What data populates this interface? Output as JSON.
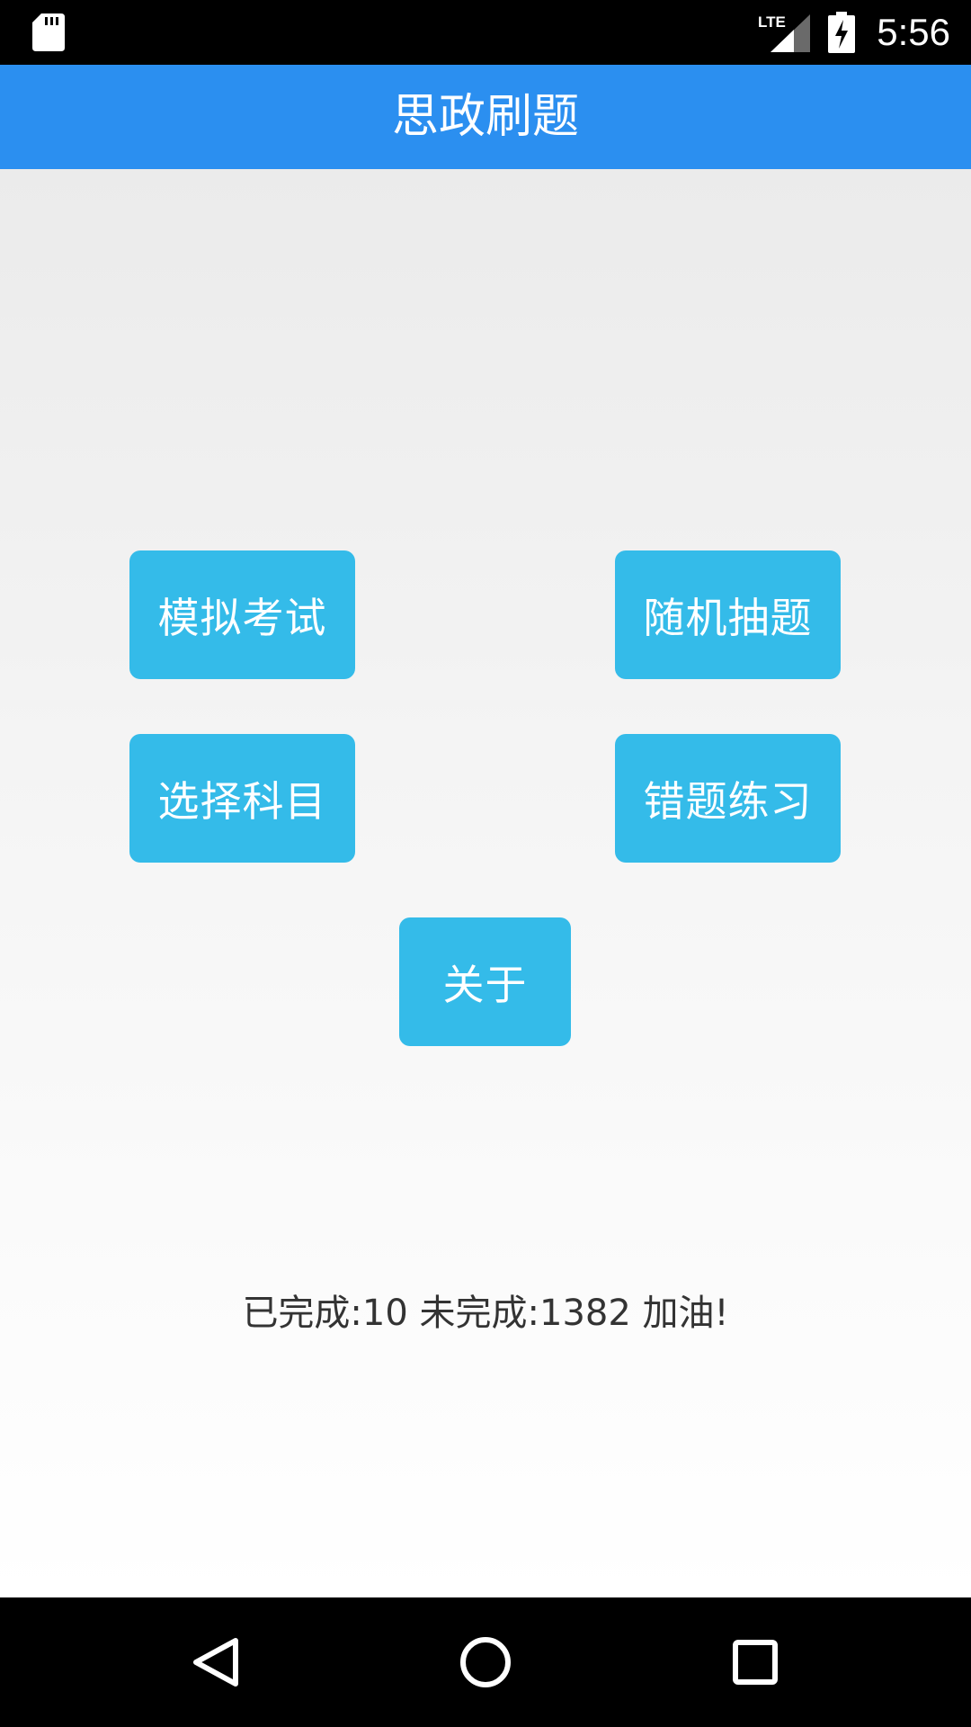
{
  "status_bar": {
    "time": "5:56",
    "network": "LTE",
    "icons": [
      "sd-card-icon",
      "lte-signal-icon",
      "battery-charging-icon"
    ]
  },
  "app_bar": {
    "title": "思政刷题",
    "color": "#2b8ff0"
  },
  "buttons": {
    "mock_exam": "模拟考试",
    "random_question": "随机抽题",
    "select_subject": "选择科目",
    "wrong_practice": "错题练习",
    "about": "关于",
    "color": "#34bbe9"
  },
  "progress": {
    "text": "已完成:10 未完成:1382 加油!"
  },
  "nav_bar": {
    "icons": [
      "back-icon",
      "home-icon",
      "recent-apps-icon"
    ]
  }
}
